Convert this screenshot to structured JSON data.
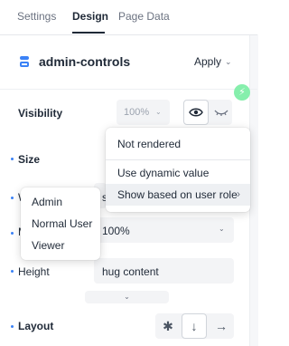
{
  "tabs": [
    {
      "label": "Settings",
      "active": false
    },
    {
      "label": "Design",
      "active": true
    },
    {
      "label": "Page Data",
      "active": false
    }
  ],
  "component": {
    "name": "admin-controls",
    "icon": "component-icon",
    "action": "Apply"
  },
  "visibility": {
    "label": "Visibility",
    "opacity": "100%",
    "icons": [
      "eye-icon",
      "eye-off-icon"
    ]
  },
  "visibility_menu": {
    "items": [
      "Not rendered",
      "Use dynamic value",
      "Show based on user role"
    ]
  },
  "size": {
    "label": "Size",
    "width_label": "W",
    "width_value_partial": "s",
    "max_label": "M",
    "max_value": "100%",
    "height_label": "Height",
    "height_value": "hug content"
  },
  "role_menu": {
    "items": [
      "Admin",
      "Normal User",
      "Viewer"
    ]
  },
  "layout": {
    "label": "Layout",
    "options": [
      "asterisk-icon",
      "arrow-down-icon",
      "arrow-right-icon"
    ],
    "selected_index": 1
  },
  "colors": {
    "accent": "#3b82f6",
    "bolt": "#86efac"
  }
}
